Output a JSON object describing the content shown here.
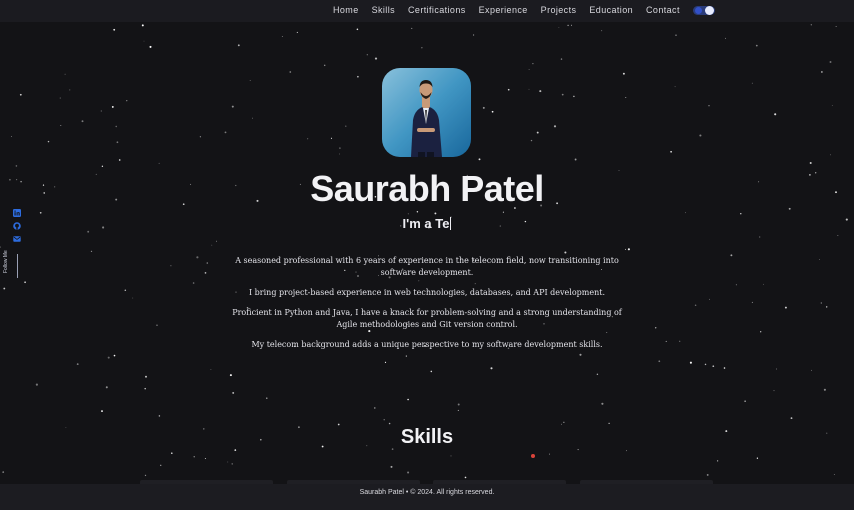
{
  "nav": {
    "items": [
      "Home",
      "Skills",
      "Certifications",
      "Experience",
      "Projects",
      "Education",
      "Contact"
    ]
  },
  "theme_toggle": {
    "icon": "theme-toggle-icon",
    "accent": "#3250c8"
  },
  "social": {
    "icons": [
      "linkedin-icon",
      "github-icon",
      "email-icon"
    ],
    "follow_label": "Follow Me",
    "accent": "#2d6cdf"
  },
  "hero": {
    "name": "Saurabh Patel",
    "typing_text": "I'm a Te",
    "bio": [
      "A seasoned professional with 6 years of experience in the telecom field, now transitioning into software development.",
      "I bring project-based experience in web technologies, databases, and API development.",
      "Proficient in Python and Java, I have a knack for problem-solving and a strong understanding of Agile methodologies and Git version control.",
      "My telecom background adds a unique perspective to my software development skills."
    ]
  },
  "skills": {
    "title": "Skills"
  },
  "footer": {
    "text": "Saurabh Patel • © 2024. All rights reserved."
  }
}
